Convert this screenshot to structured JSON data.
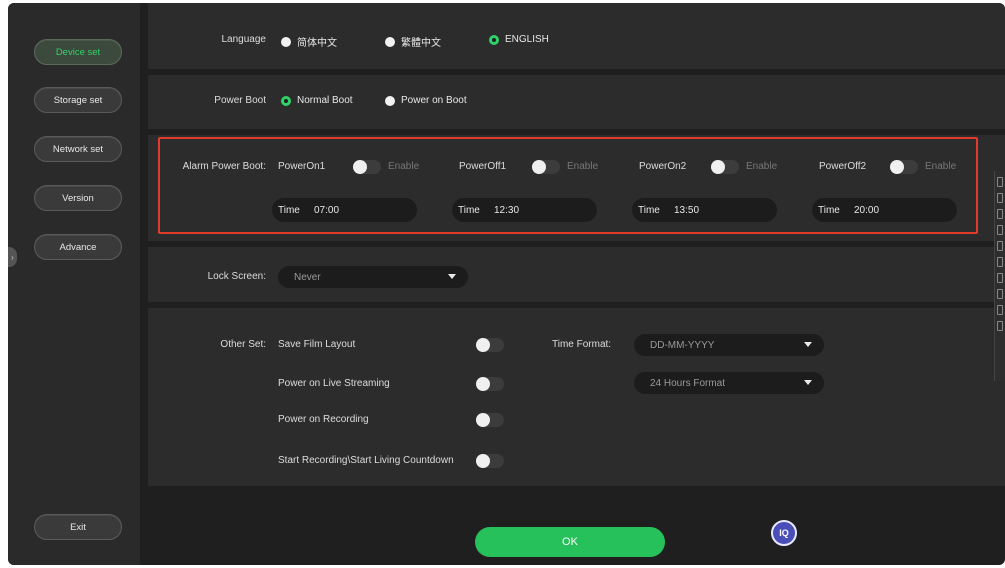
{
  "sidebar": {
    "items": [
      {
        "label": "Device set",
        "active": true
      },
      {
        "label": "Storage set",
        "active": false
      },
      {
        "label": "Network set",
        "active": false
      },
      {
        "label": "Version",
        "active": false
      },
      {
        "label": "Advance",
        "active": false
      }
    ],
    "exit_label": "Exit"
  },
  "language": {
    "label": "Language",
    "options": [
      "简体中文",
      "繁體中文",
      "ENGLISH"
    ],
    "selected": "ENGLISH"
  },
  "power_boot": {
    "label": "Power Boot",
    "options": [
      "Normal Boot",
      "Power on Boot"
    ],
    "selected": "Normal Boot"
  },
  "alarm_power_boot": {
    "label": "Alarm Power Boot:",
    "enable_label": "Enable",
    "time_label": "Time",
    "items": [
      {
        "name": "PowerOn1",
        "enabled": false,
        "time": "07:00"
      },
      {
        "name": "PowerOff1",
        "enabled": false,
        "time": "12:30"
      },
      {
        "name": "PowerOn2",
        "enabled": false,
        "time": "13:50"
      },
      {
        "name": "PowerOff2",
        "enabled": false,
        "time": "20:00"
      }
    ]
  },
  "lock_screen": {
    "label": "Lock Screen:",
    "value": "Never"
  },
  "other_set": {
    "label": "Other Set:",
    "options": [
      {
        "label": "Save Film Layout",
        "enabled": false
      },
      {
        "label": "Power on Live Streaming",
        "enabled": false
      },
      {
        "label": "Power on Recording",
        "enabled": false
      },
      {
        "label": "Start Recording\\Start Living Countdown",
        "enabled": false
      }
    ],
    "time_format_label": "Time Format:",
    "date_format": "DD-MM-YYYY",
    "hour_format": "24 Hours Format"
  },
  "footer": {
    "ok_label": "OK",
    "iq_label": "IQ"
  },
  "colors": {
    "accent": "#27c15b",
    "highlight_border": "#e23b2b",
    "iq_button": "#4a4fb8"
  }
}
